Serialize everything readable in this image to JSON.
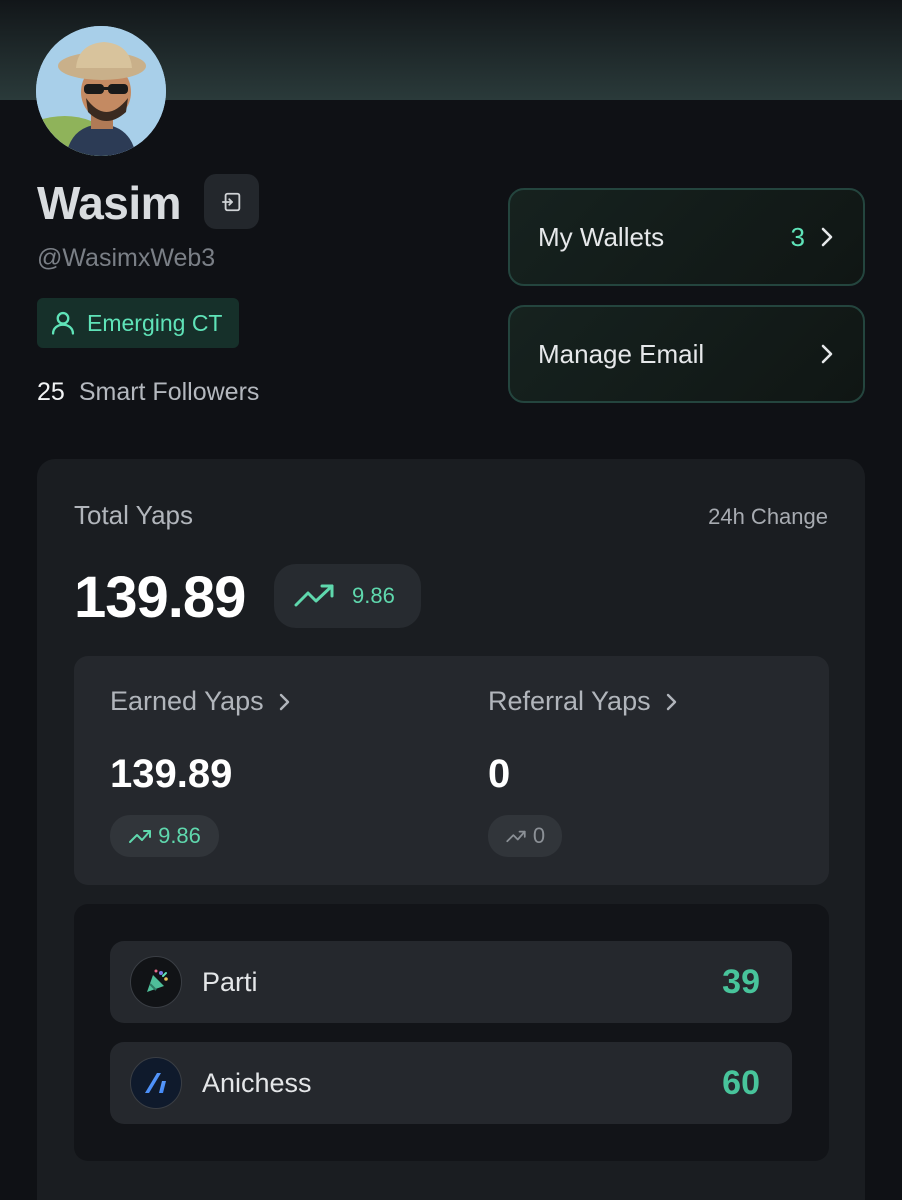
{
  "profile": {
    "name": "Wasim",
    "handle": "@WasimxWeb3",
    "badge": "Emerging CT",
    "smart_followers_count": "25",
    "smart_followers_label": "Smart Followers"
  },
  "actions": {
    "wallets_label": "My Wallets",
    "wallets_count": "3",
    "email_label": "Manage Email"
  },
  "stats": {
    "total_label": "Total Yaps",
    "change_label": "24h Change",
    "total_value": "139.89",
    "total_change": "9.86",
    "earned": {
      "label": "Earned Yaps",
      "value": "139.89",
      "change": "9.86"
    },
    "referral": {
      "label": "Referral Yaps",
      "value": "0",
      "change": "0"
    }
  },
  "projects": [
    {
      "name": "Parti",
      "score": "39",
      "icon": "party-popper-icon"
    },
    {
      "name": "Anichess",
      "score": "60",
      "icon": "anichess-logo-icon"
    }
  ],
  "colors": {
    "accent": "#5fe3b8",
    "positive": "#48c49b",
    "background": "#0f1115",
    "card": "#1a1d21"
  }
}
